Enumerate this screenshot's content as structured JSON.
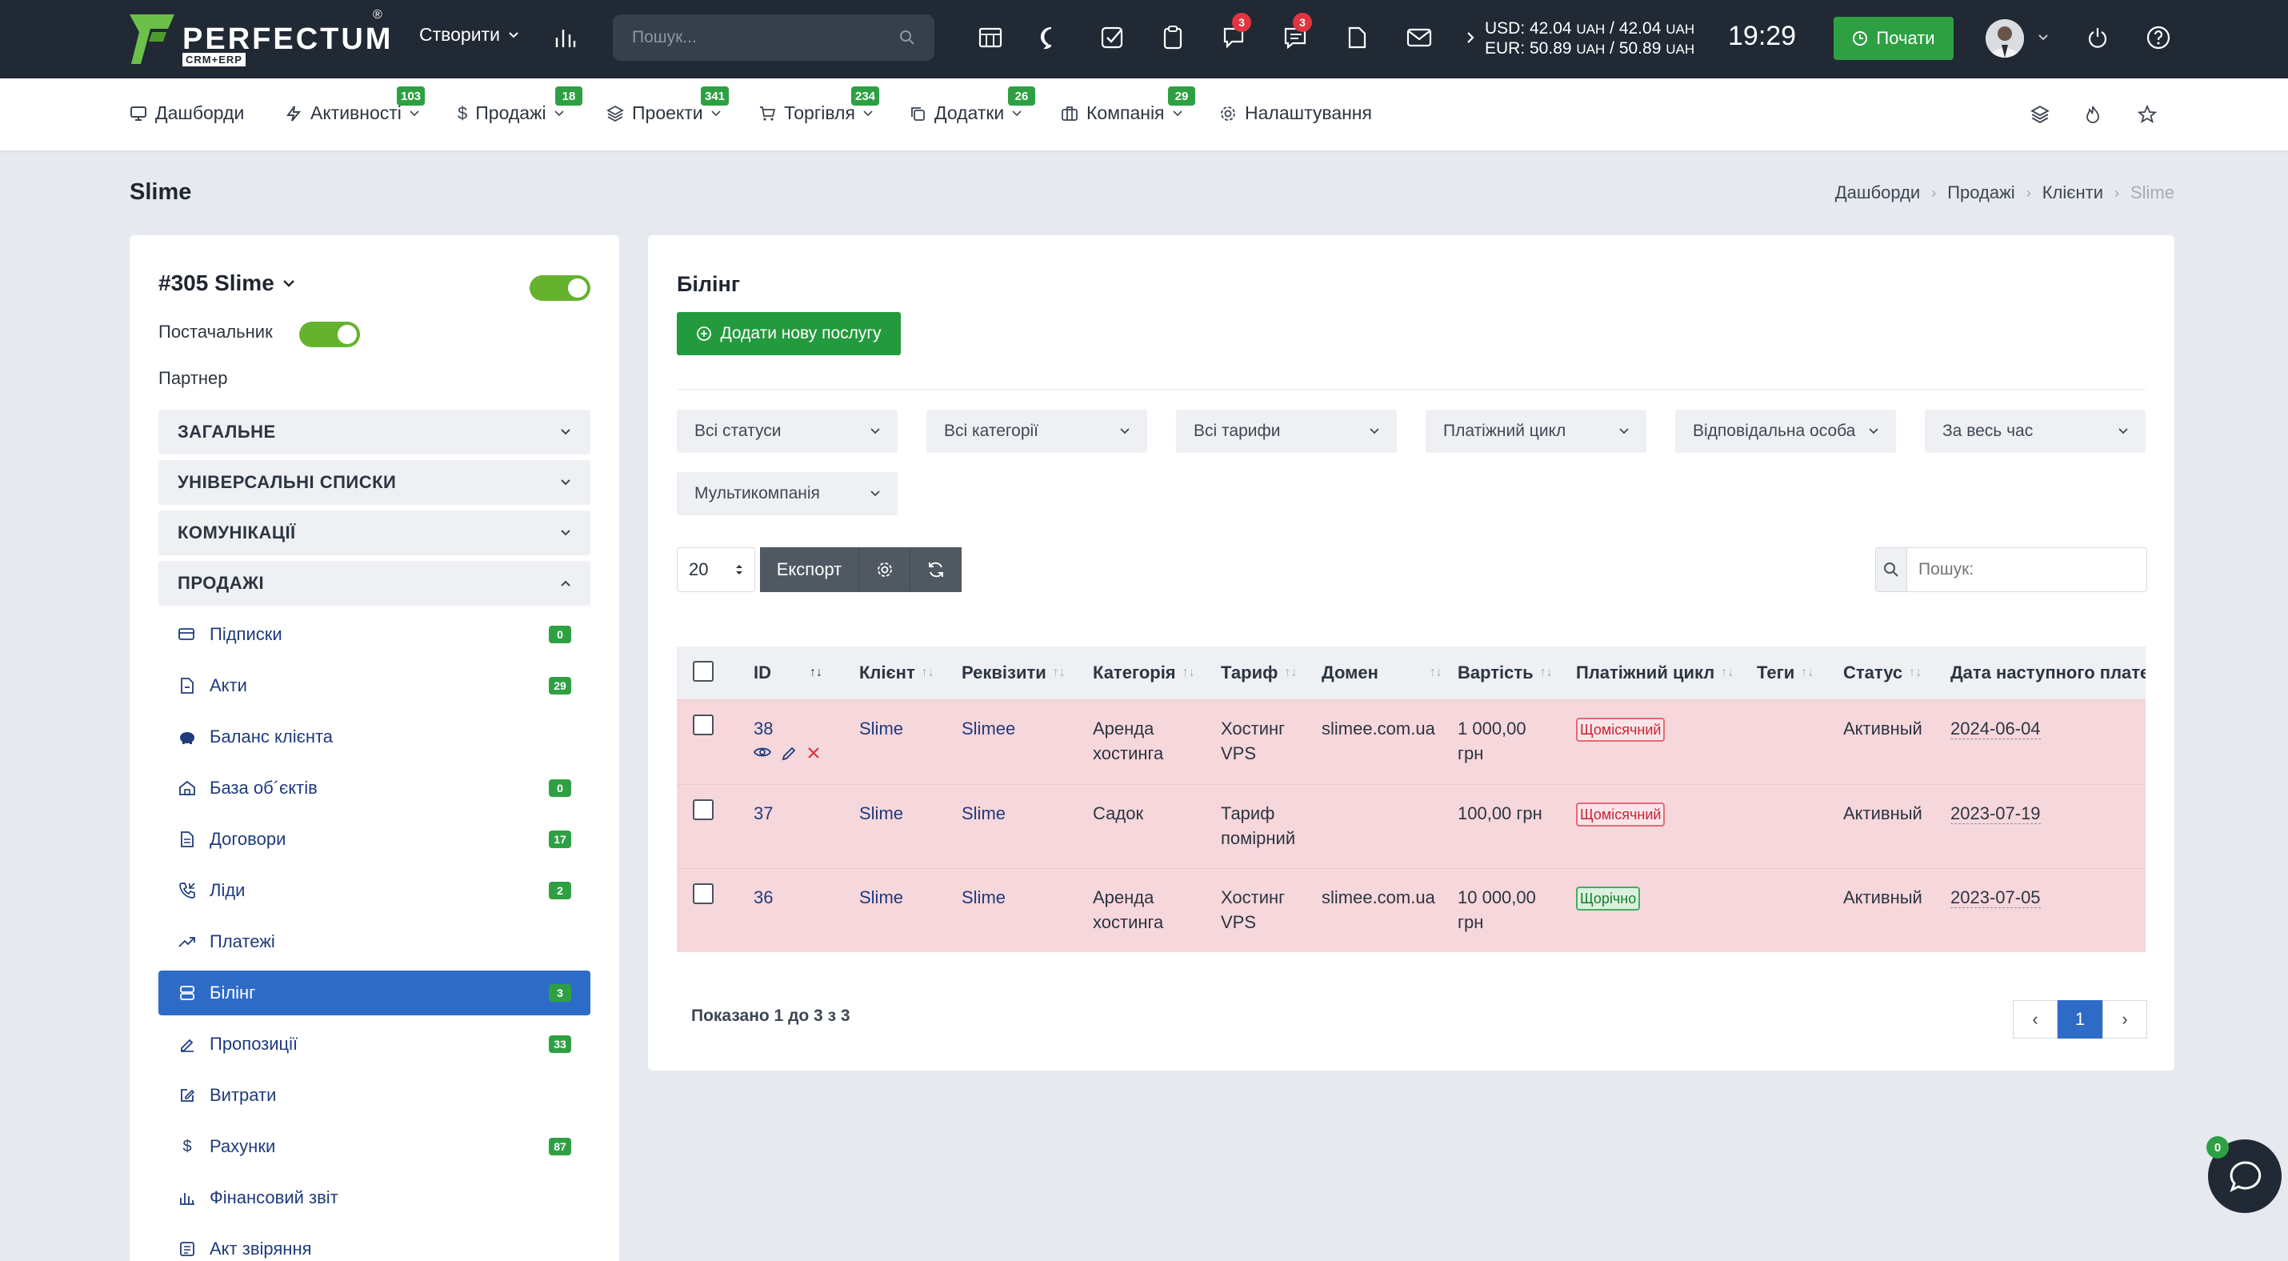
{
  "topbar": {
    "logo_text": "PERFECTUM",
    "logo_sub": "CRM+ERP",
    "logo_reg": "®",
    "create_label": "Створити",
    "search_placeholder": "Пошук...",
    "badge_chat": "3",
    "badge_messages": "3",
    "usd": "USD: 42.04",
    "usd_unit1": "UAH",
    "usd_sep": "/ 42.04",
    "usd_unit2": "UAH",
    "eur": "EUR: 50.89",
    "eur_unit1": "UAH",
    "eur_sep": "/ 50.89",
    "eur_unit2": "UAH",
    "clock": "19:29",
    "start_label": "Почати"
  },
  "menu": {
    "items": [
      {
        "label": "Дашборди",
        "badge": ""
      },
      {
        "label": "Активності",
        "badge": "103"
      },
      {
        "label": "Продажі",
        "badge": "18"
      },
      {
        "label": "Проекти",
        "badge": "341"
      },
      {
        "label": "Торгівля",
        "badge": "234"
      },
      {
        "label": "Додатки",
        "badge": "26"
      },
      {
        "label": "Компанія",
        "badge": "29"
      },
      {
        "label": "Налаштування",
        "badge": ""
      }
    ]
  },
  "page": {
    "title": "Slime",
    "breadcrumb": [
      "Дашборди",
      "Продажі",
      "Клієнти",
      "Slime"
    ]
  },
  "left": {
    "client_title": "#305 Slime",
    "supplier_label": "Постачальник",
    "partner_label": "Партнер",
    "sections": [
      "ЗАГАЛЬНЕ",
      "УНІВЕРСАЛЬНІ СПИСКИ",
      "КОМУНІКАЦІЇ",
      "ПРОДАЖІ"
    ],
    "subitems": [
      {
        "label": "Підписки",
        "badge": "0"
      },
      {
        "label": "Акти",
        "badge": "29"
      },
      {
        "label": "Баланс клієнта",
        "badge": ""
      },
      {
        "label": "База об´єктів",
        "badge": "0"
      },
      {
        "label": "Договори",
        "badge": "17"
      },
      {
        "label": "Ліди",
        "badge": "2"
      },
      {
        "label": "Платежі",
        "badge": ""
      },
      {
        "label": "Білінг",
        "badge": "3"
      },
      {
        "label": "Пропозиції",
        "badge": "33"
      },
      {
        "label": "Витрати",
        "badge": ""
      },
      {
        "label": "Рахунки",
        "badge": "87"
      },
      {
        "label": "Фінансовий звіт",
        "badge": ""
      },
      {
        "label": "Акт звіряння",
        "badge": ""
      }
    ]
  },
  "billing": {
    "title": "Білінг",
    "add_label": "Додати нову послугу",
    "filters": [
      "Всі статуси",
      "Всі категорії",
      "Всі тарифи",
      "Платіжний цикл",
      "Відповідальна особа",
      "За весь час",
      "Мультикомпанія"
    ],
    "per_page": "20",
    "export_label": "Експорт",
    "search_placeholder": "Пошук:",
    "columns": [
      "ID",
      "Клієнт",
      "Реквізити",
      "Категорія",
      "Тариф",
      "Домен",
      "Вартість",
      "Платіжний цикл",
      "Теги",
      "Статус",
      "Дата наступного платежу"
    ],
    "rows": [
      {
        "id": "38",
        "client": "Slime",
        "requisites": "Slimee",
        "category1": "Аренда",
        "category2": "хостинга",
        "tariff1": "Хостинг",
        "tariff2": "VPS",
        "domain": "slimee.com.ua",
        "cost1": "1 000,00",
        "cost2": "грн",
        "cycle": "Щомісячний",
        "tags": "",
        "status": "Активный",
        "next": "2024-06-04"
      },
      {
        "id": "37",
        "client": "Slime",
        "requisites": "Slime",
        "category1": "Садок",
        "category2": "",
        "tariff1": "Тариф",
        "tariff2": "помірний",
        "domain": "",
        "cost1": "100,00 грн",
        "cost2": "",
        "cycle": "Щомісячний",
        "tags": "",
        "status": "Активный",
        "next": "2023-07-19"
      },
      {
        "id": "36",
        "client": "Slime",
        "requisites": "Slime",
        "category1": "Аренда",
        "category2": "хостинга",
        "tariff1": "Хостинг",
        "tariff2": "VPS",
        "domain": "slimee.com.ua",
        "cost1": "10 000,00",
        "cost2": "грн",
        "cycle": "Щорічно",
        "tags": "",
        "status": "Активный",
        "next": "2023-07-05"
      }
    ],
    "shown_text": "Показано 1 до 3 з 3",
    "page_current": "1",
    "page_prev": "‹",
    "page_next": "›"
  },
  "chat_badge": "0",
  "colors": {
    "topbar": "#212934",
    "accent_green": "#2ea043",
    "accent_blue": "#2e6bc7",
    "row_highlight": "#f6d7dc",
    "badge_red": "#e2353f"
  }
}
